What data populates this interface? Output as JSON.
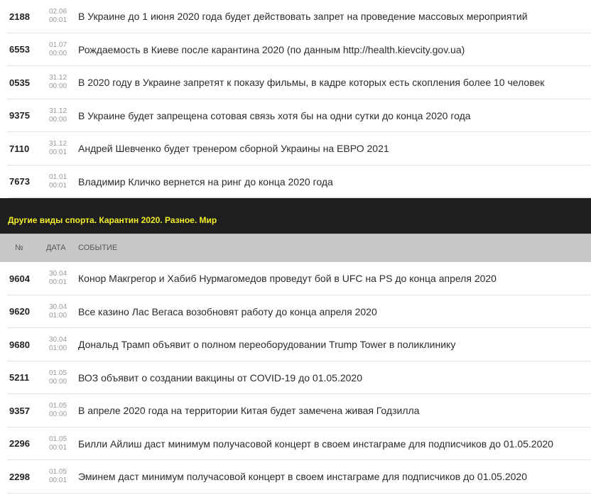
{
  "top_rows": [
    {
      "id": "2188",
      "date": "02.06",
      "time": "00:01",
      "event": "В Украине до 1 июня 2020 года будет действовать запрет на проведение массовых мероприятий"
    },
    {
      "id": "6553",
      "date": "01.07",
      "time": "00:00",
      "event": "Рождаемость в Киеве после карантина 2020 (по данным http://health.kievcity.gov.ua)"
    },
    {
      "id": "0535",
      "date": "31.12",
      "time": "00:00",
      "event": "В 2020 году в Украине запретят к показу фильмы, в кадре которых есть скопления более 10 человек"
    },
    {
      "id": "9375",
      "date": "31.12",
      "time": "00:00",
      "event": "В Украине будет запрещена сотовая связь хотя бы на одни сутки до конца 2020 года"
    },
    {
      "id": "7110",
      "date": "31.12",
      "time": "00:01",
      "event": "Андрей Шевченко будет тренером сборной Украины на ЕВРО 2021"
    },
    {
      "id": "7673",
      "date": "01.01",
      "time": "00:01",
      "event": "Владимир Кличко вернется на ринг до конца 2020 года"
    }
  ],
  "section": {
    "title": "Другие виды спорта. Карантин 2020. Разное. Мир",
    "columns": {
      "num": "№",
      "date": "ДАТА",
      "event": "СОБЫТИЕ"
    },
    "rows": [
      {
        "id": "9604",
        "date": "30.04",
        "time": "00:01",
        "event": "Конор Макгрегор и Хабиб Нурмагомедов проведут бой в UFC на PS до конца апреля 2020"
      },
      {
        "id": "9620",
        "date": "30.04",
        "time": "01:00",
        "event": "Все казино Лас Вегаса возобновят работу до конца апреля 2020"
      },
      {
        "id": "9680",
        "date": "30.04",
        "time": "01:00",
        "event": "Дональд Трамп объявит о полном переоборудовании Trump Tower в поликлинику"
      },
      {
        "id": "5211",
        "date": "01.05",
        "time": "00:00",
        "event": "ВОЗ объявит о создании вакцины от COVID-19 до 01.05.2020"
      },
      {
        "id": "9357",
        "date": "01.05",
        "time": "00:00",
        "event": "В апреле 2020 года на территории Китая будет замечена живая Годзилла"
      },
      {
        "id": "2296",
        "date": "01.05",
        "time": "00:01",
        "event": "Билли Айлиш даст минимум получасовой концерт в своем инстаграме для подписчиков до 01.05.2020"
      },
      {
        "id": "2298",
        "date": "01.05",
        "time": "00:01",
        "event": "Эминем даст минимум получасовой концерт в своем инстаграме для подписчиков до 01.05.2020"
      }
    ]
  }
}
